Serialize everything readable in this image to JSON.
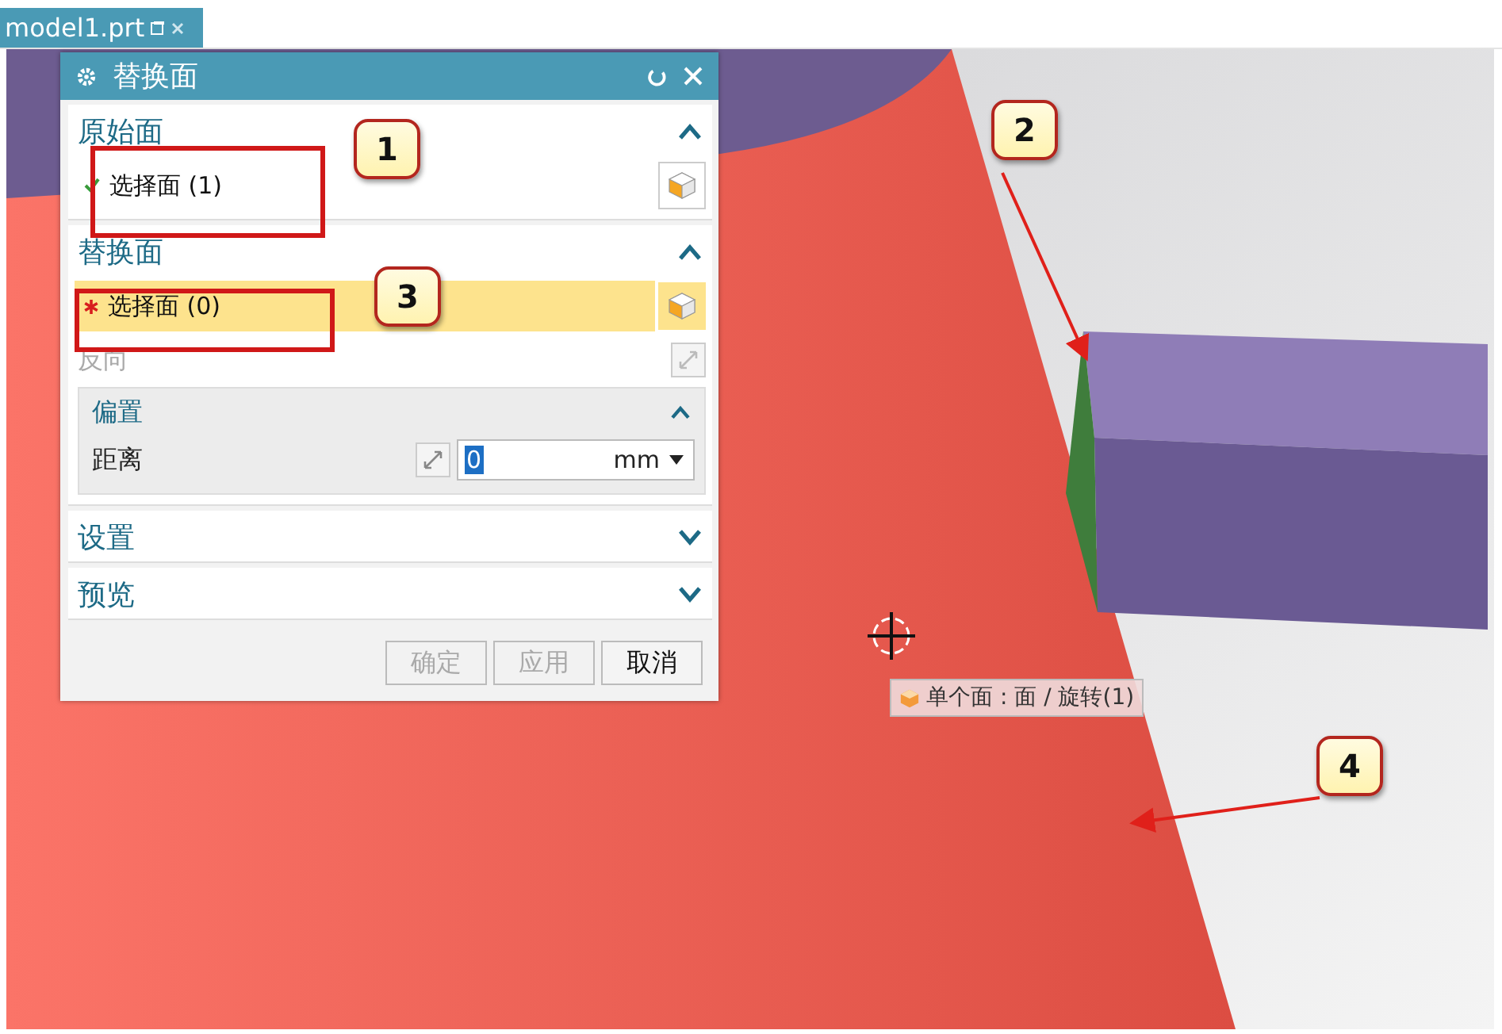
{
  "tab": {
    "title": "model1.prt"
  },
  "dialog": {
    "title": "替换面",
    "sections": [
      {
        "title": "原始面",
        "expanded": true,
        "rows": [
          {
            "kind": "selector",
            "label": "选择面 (1)",
            "complete": true,
            "selected": false
          }
        ]
      },
      {
        "title": "替换面",
        "expanded": true,
        "rows": [
          {
            "kind": "selector",
            "label": "选择面 (0)",
            "complete": false,
            "selected": true
          },
          {
            "kind": "toggle",
            "label": "反向",
            "disabled": true
          },
          {
            "kind": "group",
            "title": "偏置",
            "expanded": true,
            "field": {
              "label": "距离",
              "value": "0",
              "unit": "mm"
            }
          }
        ]
      },
      {
        "title": "设置",
        "expanded": false
      },
      {
        "title": "预览",
        "expanded": false
      }
    ],
    "buttons": [
      {
        "label": "确定",
        "disabled": true
      },
      {
        "label": "应用",
        "disabled": true
      },
      {
        "label": "取消",
        "disabled": false
      }
    ]
  },
  "tooltip": {
    "text": "单个面 : 面 / 旋转(1)"
  },
  "callouts": [
    {
      "label": "1"
    },
    {
      "label": "2"
    },
    {
      "label": "3"
    },
    {
      "label": "4"
    }
  ]
}
